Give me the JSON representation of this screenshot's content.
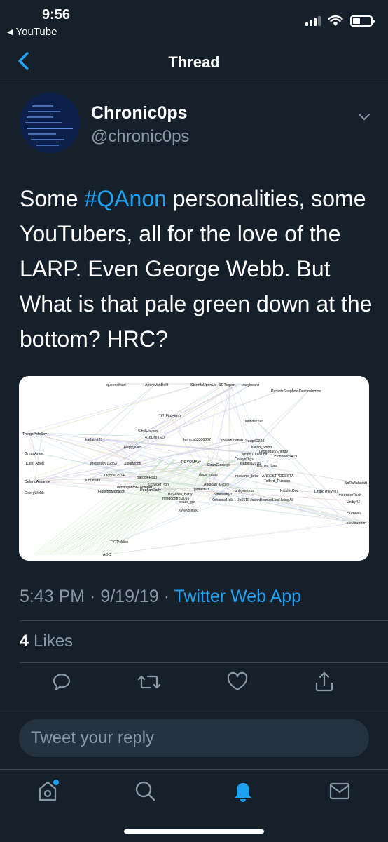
{
  "status": {
    "time": "9:56",
    "back_app": "YouTube"
  },
  "nav": {
    "title": "Thread"
  },
  "author": {
    "name": "Chronic0ps",
    "handle": "@chronic0ps"
  },
  "tweet": {
    "text_before": "Some ",
    "hashtag": "#QAnon",
    "text_after": " personalities, some YouTubers, all for the love of the LARP.  Even George Webb. But What is that pale green down at the bottom?  HRC?"
  },
  "media": {
    "labels": [
      "queenofhart",
      "AndreVanDelft",
      "StormIsUponUs",
      "SGTreport",
      "tracybeanz",
      "PatriotsSoapbox",
      "DustinNemos",
      "Tiff_FitzHenry",
      "infinitechan",
      "SibylHaynes",
      "kadath123",
      "416UNITED",
      "terryca53306307",
      "souleducation11",
      "redpill2323",
      "Kevin_Shipp",
      "LegendaryEnergy",
      "ThingsPoleSay",
      "HappyKat5",
      "lightof1000suns",
      "JSchneeds419",
      "CoreysDigs",
      "isabella2016",
      "PGYOMAsy",
      "SloanGiddings",
      "Barnes_Law",
      "GroupAnon",
      "Melissa0916863",
      "XiolaMoon",
      "Kate_Anon",
      "OutoftheGSTE",
      "lum3natti",
      "BarcoleRikki",
      "docs_edgar",
      "madame_briar",
      "ARRESTPODESTA",
      "Telford_Russian",
      "SoRaAshcraft",
      "DefendAssange",
      "movingonmoZoomper",
      "crowder_ron",
      "GeorgWebb",
      "FightingMonarch",
      "ReaganEarly",
      "Ateskari_Gypsy",
      "jamiedlux",
      "antigeekess",
      "KidsIncDoc",
      "LiftingTheVeil7",
      "ImperatorTruth",
      "Uniby4J",
      "Simmertry1",
      "KohannaHala",
      "Jp5510",
      "JasonBermasLiesHidingAll",
      "BayArea_Betty",
      "mindcontrol2016",
      "peace_got",
      "cr0meeil",
      "steviouotrim",
      "KyleKolinski",
      "TYTPolitics",
      "AOC"
    ]
  },
  "meta": {
    "time": "5:43 PM",
    "date": "9/19/19",
    "sep": " · ",
    "app": "Twitter Web App"
  },
  "stats": {
    "likes_count": "4",
    "likes_label": "Likes"
  },
  "reply": {
    "placeholder": "Tweet your reply"
  },
  "colors": {
    "accent": "#1da1f2",
    "background": "#15202b",
    "secondary_text": "#8899a6",
    "divider": "#38444d"
  },
  "icons": {
    "nav": [
      "back-chevron-icon"
    ],
    "actions": [
      "reply-icon",
      "retweet-icon",
      "like-icon",
      "share-icon"
    ],
    "tabs": [
      "home-icon",
      "search-icon",
      "notifications-icon",
      "messages-icon"
    ]
  }
}
